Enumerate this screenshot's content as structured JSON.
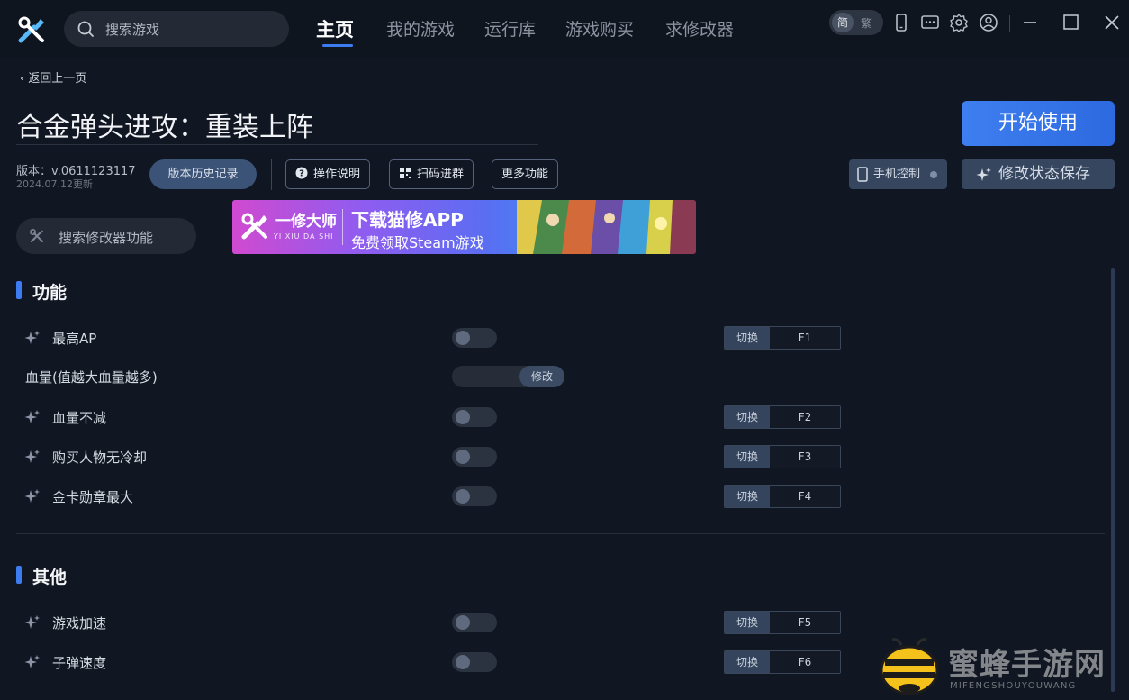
{
  "topbar": {
    "search_placeholder": "搜索游戏",
    "tabs": [
      "主页",
      "我的游戏",
      "运行库",
      "游戏购买",
      "求修改器"
    ],
    "active_tab": 0,
    "lang_on": "简",
    "lang_off": "繁"
  },
  "header": {
    "back_label": "返回上一页",
    "title": "合金弹头进攻：重装上阵",
    "start_label": "开始使用",
    "version": "版本：v.0611123117",
    "update_date": "2024.07.12更新",
    "history_label": "版本历史记录",
    "help_label": "操作说明",
    "qr_label": "扫码进群",
    "more_label": "更多功能",
    "phone_label": "手机控制",
    "save_label": "修改状态保存"
  },
  "function_search_placeholder": "搜索修改器功能",
  "banner": {
    "brand": "一修大师",
    "brand_en": "YI XIU DA SHI",
    "headline": "下载猫修APP",
    "subline": "免费领取Steam游戏"
  },
  "sections": [
    {
      "title": "功能",
      "rows": [
        {
          "label": "最高AP",
          "type": "toggle",
          "switch_label": "切换",
          "key": "F1"
        },
        {
          "label": "血量(值越大血量越多)",
          "type": "slider",
          "button_label": "修改"
        },
        {
          "label": "血量不减",
          "type": "toggle",
          "switch_label": "切换",
          "key": "F2"
        },
        {
          "label": "购买人物无冷却",
          "type": "toggle",
          "switch_label": "切换",
          "key": "F3"
        },
        {
          "label": "金卡勋章最大",
          "type": "toggle",
          "switch_label": "切换",
          "key": "F4"
        }
      ]
    },
    {
      "title": "其他",
      "rows": [
        {
          "label": "游戏加速",
          "type": "toggle",
          "switch_label": "切换",
          "key": "F5"
        },
        {
          "label": "子弹速度",
          "type": "toggle",
          "switch_label": "切换",
          "key": "F6"
        }
      ]
    }
  ],
  "watermark": {
    "cn": "蜜蜂手游网",
    "en": "MIFENGSHOUYOUWANG"
  },
  "colors": {
    "accent": "#3d7bf0",
    "background": "#111722"
  }
}
